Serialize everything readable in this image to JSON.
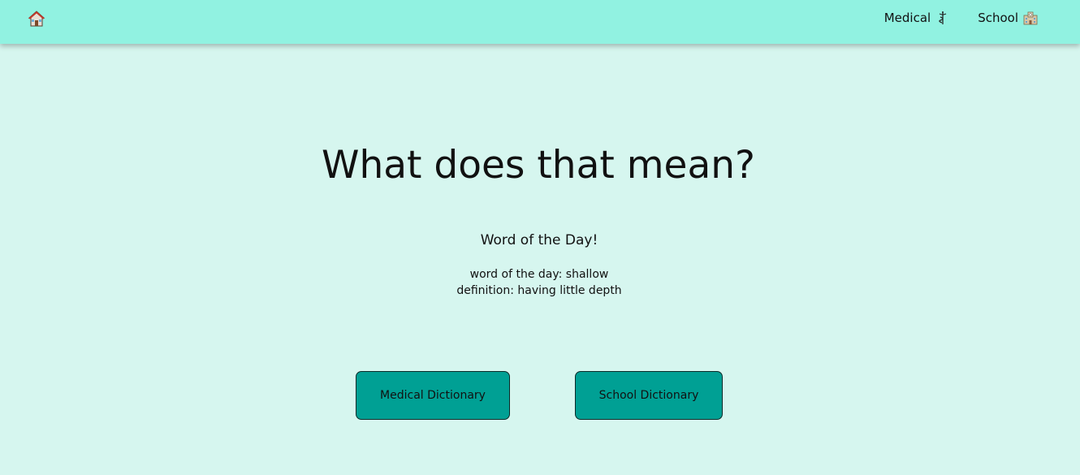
{
  "nav": {
    "home_icon": "house-icon",
    "links": [
      {
        "label": "Medical",
        "icon": "caduceus-icon"
      },
      {
        "label": "School",
        "icon": "school-building-icon"
      }
    ]
  },
  "main": {
    "title": "What does that mean?",
    "word_of_day": {
      "heading": "Word of the Day!",
      "word_line": "word of the day: shallow",
      "definition_line": "definition: having little depth"
    },
    "buttons": {
      "medical": "Medical Dictionary",
      "school": "School Dictionary"
    }
  },
  "colors": {
    "navbar": "#91f2e1",
    "background": "#d6f6ef",
    "button": "#00a094"
  }
}
